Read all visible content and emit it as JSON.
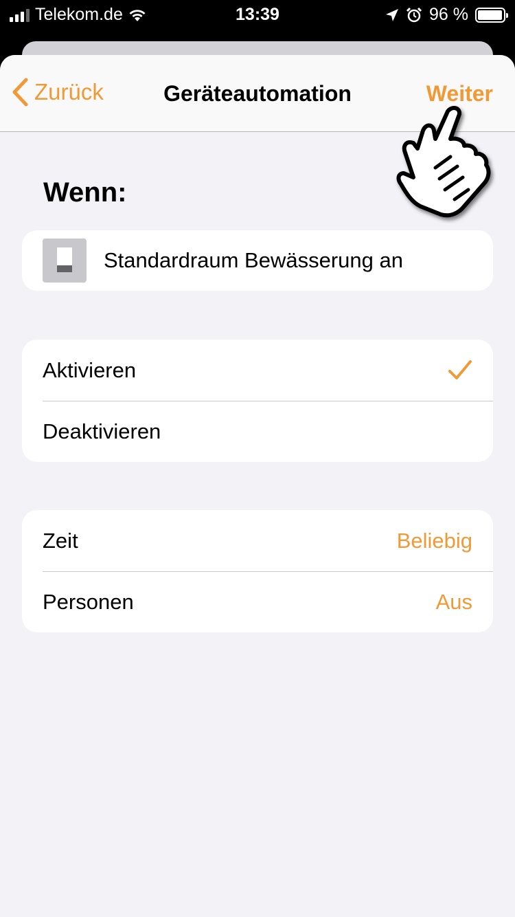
{
  "status_bar": {
    "carrier": "Telekom.de",
    "time": "13:39",
    "battery": "96 %",
    "battery_level": 0.96
  },
  "nav": {
    "back_label": "Zurück",
    "title": "Geräteautomation",
    "next_label": "Weiter"
  },
  "trigger": {
    "section_title": "Wenn:",
    "device_label": "Standardraum Bewässerung an"
  },
  "action_options": [
    {
      "label": "Aktivieren",
      "selected": true
    },
    {
      "label": "Deaktivieren",
      "selected": false
    }
  ],
  "conditions": [
    {
      "label": "Zeit",
      "value": "Beliebig"
    },
    {
      "label": "Personen",
      "value": "Aus"
    }
  ],
  "colors": {
    "accent": "#f09a37",
    "background": "#f2f2f7",
    "card": "#ffffff"
  },
  "icons": [
    "signal-icon",
    "wifi-icon",
    "location-icon",
    "alarm-icon",
    "battery-icon",
    "chevron-left-icon",
    "device-switch-icon",
    "checkmark-icon",
    "hand-pointer-icon"
  ]
}
